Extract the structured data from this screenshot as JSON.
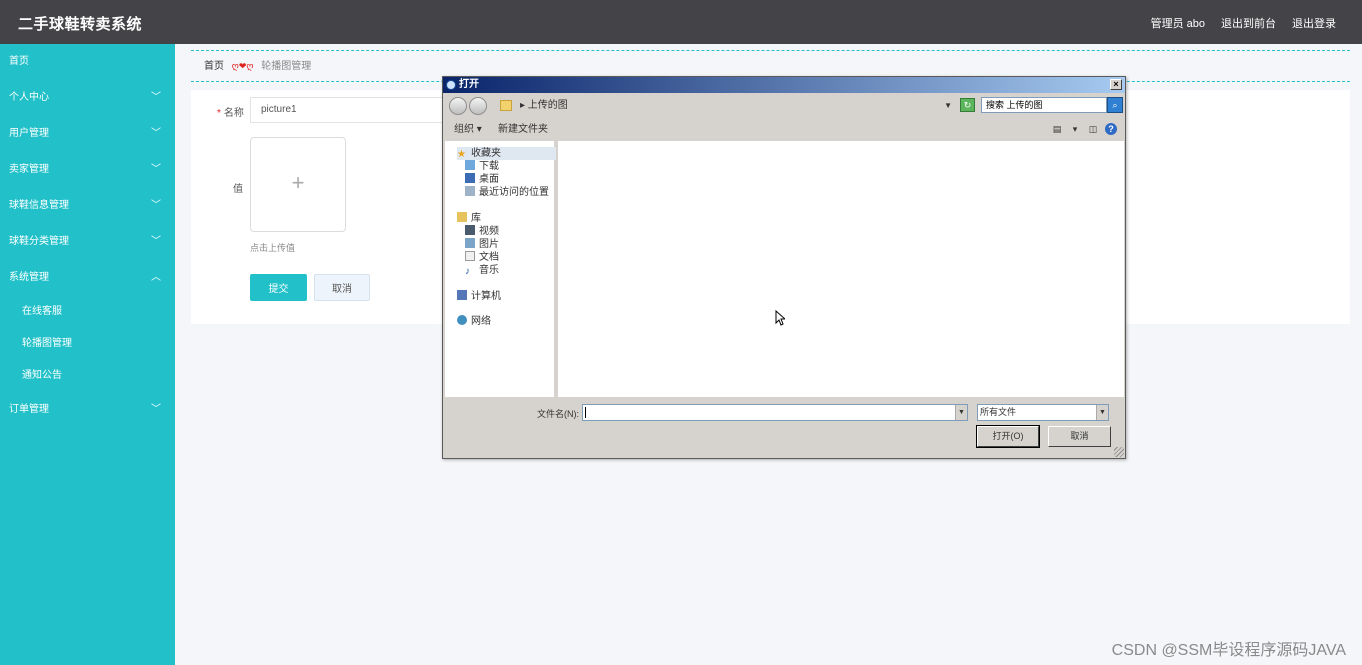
{
  "app": {
    "title": "二手球鞋转卖系统",
    "header_links": [
      "管理员 abo",
      "退出到前台",
      "退出登录"
    ]
  },
  "sidebar": {
    "items": [
      {
        "label": "首页",
        "chevron": ""
      },
      {
        "label": "个人中心",
        "chevron": "﹀"
      },
      {
        "label": "用户管理",
        "chevron": "﹀"
      },
      {
        "label": "卖家管理",
        "chevron": "﹀"
      },
      {
        "label": "球鞋信息管理",
        "chevron": "﹀"
      },
      {
        "label": "球鞋分类管理",
        "chevron": "﹀"
      },
      {
        "label": "系统管理",
        "chevron": "︿"
      }
    ],
    "sub_items": [
      "在线客服",
      "轮播图管理",
      "通知公告"
    ],
    "last_item": {
      "label": "订单管理",
      "chevron": "﹀"
    }
  },
  "breadcrumb": {
    "home": "首页",
    "separator": "ღ❤ღ",
    "current": "轮播图管理"
  },
  "form": {
    "name_label": "名称",
    "required_mark": "*",
    "name_value": "picture1",
    "value_label": "值",
    "upload_plus": "+",
    "upload_hint": "点击上传值",
    "submit": "提交",
    "cancel": "取消"
  },
  "dialog": {
    "title": "打开",
    "close": "×",
    "address": "▸ 上传的图",
    "search_placeholder": "搜索 上传的图",
    "organize": "组织 ▾",
    "new_folder": "新建文件夹",
    "tree": [
      {
        "label": "收藏夹",
        "icon": "star-icon",
        "selected": true
      },
      {
        "label": "下载",
        "icon": "download-icon"
      },
      {
        "label": "桌面",
        "icon": "desktop-icon"
      },
      {
        "label": "最近访问的位置",
        "icon": "recent-icon"
      },
      {
        "label": "库",
        "icon": "library-icon"
      },
      {
        "label": "视频",
        "icon": "video-icon"
      },
      {
        "label": "图片",
        "icon": "picture-icon"
      },
      {
        "label": "文档",
        "icon": "document-icon"
      },
      {
        "label": "音乐",
        "icon": "music-icon"
      },
      {
        "label": "计算机",
        "icon": "computer-icon"
      },
      {
        "label": "网络",
        "icon": "network-icon"
      }
    ],
    "filename_label": "文件名(N):",
    "filename_value": "",
    "filetype": "所有文件",
    "open_button": "打开(O)",
    "cancel_button": "取消"
  },
  "watermark": "CSDN @SSM毕设程序源码JAVA",
  "colors": {
    "sidebar": "#22c1c9",
    "topbar": "#444448",
    "accent": "#22c1c9"
  }
}
